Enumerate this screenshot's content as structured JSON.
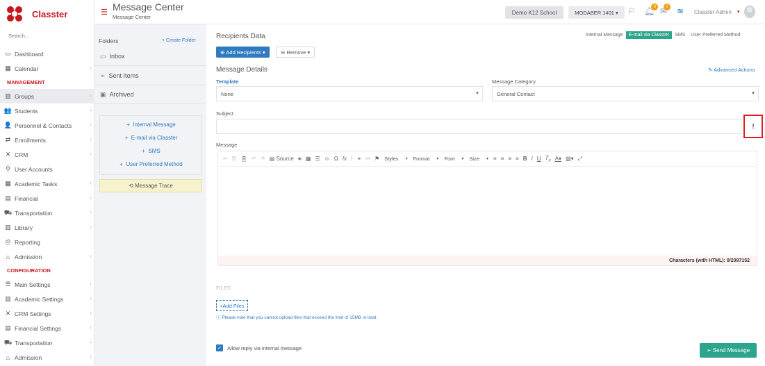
{
  "app": {
    "name": "Classter",
    "brand_color": "#c8161d"
  },
  "sidebar": {
    "search_placeholder": "Search...",
    "items_top": [
      {
        "label": "Dashboard",
        "icon": "laptop-icon",
        "glyph": "▭",
        "chev": ""
      },
      {
        "label": "Calendar",
        "icon": "calendar-icon",
        "glyph": "▦",
        "chev": "‹"
      }
    ],
    "section_management": "MANAGEMENT",
    "items_management": [
      {
        "label": "Groups",
        "icon": "groups-icon",
        "glyph": "▥",
        "chev": "‹",
        "active": true
      },
      {
        "label": "Students",
        "icon": "students-icon",
        "glyph": "👥",
        "chev": "‹"
      },
      {
        "label": "Personnel & Contacts",
        "icon": "personnel-icon",
        "glyph": "👤",
        "chev": "‹"
      },
      {
        "label": "Enrollments",
        "icon": "enrollments-icon",
        "glyph": "⇄",
        "chev": "‹"
      },
      {
        "label": "CRM",
        "icon": "crm-icon",
        "glyph": "✕",
        "chev": "‹"
      },
      {
        "label": "User Accounts",
        "icon": "key-icon",
        "glyph": "⚲",
        "chev": ""
      },
      {
        "label": "Academic Tasks",
        "icon": "tasks-icon",
        "glyph": "▦",
        "chev": "‹"
      },
      {
        "label": "Financial",
        "icon": "financial-icon",
        "glyph": "▤",
        "chev": "‹"
      },
      {
        "label": "Transportation",
        "icon": "bus-icon",
        "glyph": "⛟",
        "chev": "‹"
      },
      {
        "label": "Library",
        "icon": "library-icon",
        "glyph": "▥",
        "chev": "‹"
      },
      {
        "label": "Reporting",
        "icon": "print-icon",
        "glyph": "⎙",
        "chev": ""
      },
      {
        "label": "Admission",
        "icon": "admission-icon",
        "glyph": "⌂",
        "chev": "‹"
      }
    ],
    "section_configuration": "CONFIGURATION",
    "items_configuration": [
      {
        "label": "Main Settings",
        "icon": "sliders-icon",
        "glyph": "☰",
        "chev": "‹"
      },
      {
        "label": "Academic Settings",
        "icon": "academic-settings-icon",
        "glyph": "▥",
        "chev": "‹"
      },
      {
        "label": "CRM Settings",
        "icon": "crm-settings-icon",
        "glyph": "✕",
        "chev": "‹"
      },
      {
        "label": "Financial Settings",
        "icon": "financial-settings-icon",
        "glyph": "▤",
        "chev": "‹"
      },
      {
        "label": "Transportation",
        "icon": "bus-icon",
        "glyph": "⛟",
        "chev": "‹"
      },
      {
        "label": "Admission",
        "icon": "admission-icon",
        "glyph": "⌂",
        "chev": "‹"
      }
    ]
  },
  "header": {
    "title": "Message Center",
    "breadcrumb": "Message Center",
    "school": "Demo K12 School",
    "year": "MODABER 1401",
    "notifications_count": "0",
    "messages_count": "0",
    "user": "Classter Admin"
  },
  "folders": {
    "title": "Folders",
    "create_label": "Create Folder",
    "items": [
      {
        "label": "Inbox",
        "icon": "inbox-icon",
        "glyph": "▭"
      },
      {
        "label": "Sent Items",
        "icon": "send-icon",
        "glyph": "➢"
      },
      {
        "label": "Archived",
        "icon": "archive-icon",
        "glyph": "▣"
      }
    ],
    "compose_links": [
      "Internal Message",
      "E-mail via Classter",
      "SMS",
      "User Preferred Method"
    ],
    "trace_label": "Message Trace"
  },
  "main": {
    "recipients_title": "Recipients Data",
    "channels": [
      {
        "label": "Internal Message",
        "active": false
      },
      {
        "label": "E-mail via Classter",
        "active": true
      },
      {
        "label": "SMS",
        "active": false
      },
      {
        "label": "User Preferred Method",
        "active": false
      }
    ],
    "add_recipients": "Add Recipients",
    "remove": "Remove",
    "details_title": "Message Details",
    "advanced_actions": "Advanced Actions",
    "template_label": "Template",
    "template_value": "None",
    "category_label": "Message Category",
    "category_value": "General Contact",
    "subject_label": "Subject",
    "subject_value": "",
    "warn_label": "!",
    "message_label": "Message",
    "toolbar": {
      "source": "Source",
      "styles": "Styles",
      "format": "Format",
      "font": "Font",
      "size": "Size"
    },
    "char_count": "Characters (with HTML): 0/2097152",
    "files_title": "FILES",
    "add_files": "Add Files",
    "files_note": "Please note that you cannot upload files that exceed the limit of 15MB in total.",
    "allow_reply": "Allow reply via internal message",
    "send": "Send Message"
  }
}
